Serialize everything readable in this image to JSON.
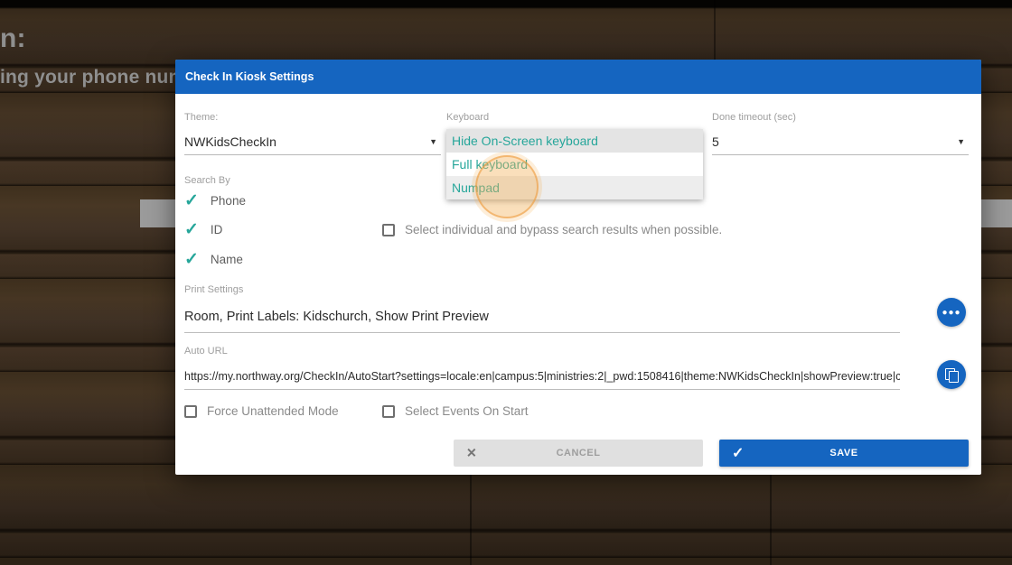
{
  "background": {
    "heading_fragment": "n:",
    "subheading_fragment": "ing your phone number"
  },
  "dialog": {
    "title": "Check In Kiosk Settings",
    "theme": {
      "label": "Theme:",
      "value": "NWKidsCheckIn"
    },
    "keyboard": {
      "label": "Keyboard",
      "options": [
        "Hide On-Screen keyboard",
        "Full keyboard",
        "Numpad"
      ],
      "selected": "Hide On-Screen keyboard"
    },
    "done_timeout": {
      "label": "Done timeout (sec)",
      "value": "5"
    },
    "search_by": {
      "label": "Search By",
      "items": [
        "Phone",
        "ID",
        "Name"
      ]
    },
    "bypass_label": "Select individual and bypass search results when possible.",
    "print_settings": {
      "label": "Print Settings",
      "value": "Room,  Print Labels: Kidschurch,  Show Print Preview"
    },
    "auto_url": {
      "label": "Auto URL",
      "value": "https://my.northway.org/CheckIn/AutoStart?settings=locale:en|campus:5|ministries:2|_pwd:1508416|theme:NWKidsCheckIn|showPreview:true|che"
    },
    "force_unattended_label": "Force Unattended Mode",
    "select_events_label": "Select Events On Start",
    "buttons": {
      "cancel": "CANCEL",
      "save": "SAVE"
    }
  },
  "colors": {
    "primary_blue": "#1565c0",
    "accent_teal": "#26a69a",
    "dropdown_highlight": "#e4e4e4",
    "click_indicator_orange": "#f0a24a"
  }
}
